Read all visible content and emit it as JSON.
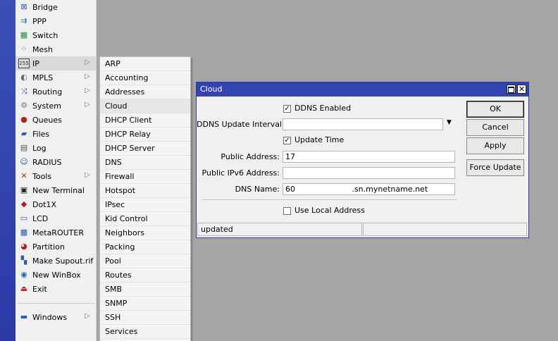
{
  "main_menu": [
    {
      "label": "Bridge",
      "icon": "bridge-icon",
      "glyph": "⊠",
      "color": "#2b5eaa"
    },
    {
      "label": "PPP",
      "icon": "ppp-icon",
      "glyph": "⇉",
      "color": "#2b5eaa"
    },
    {
      "label": "Switch",
      "icon": "switch-icon",
      "glyph": "▦",
      "color": "#2a8a3a"
    },
    {
      "label": "Mesh",
      "icon": "mesh-icon",
      "glyph": "⁘",
      "color": "#2b5eaa"
    },
    {
      "label": "IP",
      "icon": "ip-icon",
      "glyph": "255",
      "color": "#333333",
      "submenu": true
    },
    {
      "label": "MPLS",
      "icon": "mpls-icon",
      "glyph": "◐",
      "color": "#666666",
      "submenu": true
    },
    {
      "label": "Routing",
      "icon": "routing-icon",
      "glyph": "⤨",
      "color": "#2b5eaa",
      "submenu": true
    },
    {
      "label": "System",
      "icon": "system-icon",
      "glyph": "⚙",
      "color": "#777777",
      "submenu": true
    },
    {
      "label": "Queues",
      "icon": "queues-icon",
      "glyph": "●",
      "color": "#b22222"
    },
    {
      "label": "Files",
      "icon": "files-icon",
      "glyph": "▰",
      "color": "#2b5eaa"
    },
    {
      "label": "Log",
      "icon": "log-icon",
      "glyph": "▤",
      "color": "#555555"
    },
    {
      "label": "RADIUS",
      "icon": "radius-icon",
      "glyph": "☺",
      "color": "#2b5eaa"
    },
    {
      "label": "Tools",
      "icon": "tools-icon",
      "glyph": "✕",
      "color": "#8b4513",
      "submenu": true
    },
    {
      "label": "New Terminal",
      "icon": "terminal-icon",
      "glyph": "▣",
      "color": "#222222"
    },
    {
      "label": "Dot1X",
      "icon": "dot1x-icon",
      "glyph": "◆",
      "color": "#b22222"
    },
    {
      "label": "LCD",
      "icon": "lcd-icon",
      "glyph": "▭",
      "color": "#2b5eaa"
    },
    {
      "label": "MetaROUTER",
      "icon": "metarouter-icon",
      "glyph": "▩",
      "color": "#2b5eaa"
    },
    {
      "label": "Partition",
      "icon": "partition-icon",
      "glyph": "◕",
      "color": "#b22222"
    },
    {
      "label": "Make Supout.rif",
      "icon": "supout-icon",
      "glyph": "▚",
      "color": "#2b5eaa"
    },
    {
      "label": "New WinBox",
      "icon": "winbox-icon",
      "glyph": "◉",
      "color": "#2b5eaa"
    },
    {
      "label": "Exit",
      "icon": "exit-icon",
      "glyph": "⏏",
      "color": "#b22222"
    }
  ],
  "windows_item": {
    "label": "Windows",
    "icon": "windows-icon",
    "glyph": "▬",
    "color": "#2b5eaa"
  },
  "ip_submenu": [
    "ARP",
    "Accounting",
    "Addresses",
    "Cloud",
    "DHCP Client",
    "DHCP Relay",
    "DHCP Server",
    "DNS",
    "Firewall",
    "Hotspot",
    "IPsec",
    "Kid Control",
    "Neighbors",
    "Packing",
    "Pool",
    "Routes",
    "SMB",
    "SNMP",
    "SSH",
    "Services"
  ],
  "dialog": {
    "title": "Cloud",
    "ddns_enabled_label": "DDNS Enabled",
    "ddns_enabled_checked": true,
    "ddns_interval_label": "DDNS Update Interval:",
    "ddns_interval_value": "",
    "update_time_label": "Update Time",
    "update_time_checked": true,
    "public_address_label": "Public Address:",
    "public_address_value": "17",
    "public_ipv6_label": "Public IPv6 Address:",
    "public_ipv6_value": "",
    "dns_name_label": "DNS Name:",
    "dns_name_value": "60                       .sn.mynetname.net",
    "use_local_label": "Use Local Address",
    "use_local_checked": false,
    "buttons": {
      "ok": "OK",
      "cancel": "Cancel",
      "apply": "Apply",
      "force_update": "Force Update"
    },
    "status_left": "updated",
    "status_right": ""
  },
  "colors": {
    "desktop": "#a5a5a5",
    "sidebar": "#3344b0",
    "titlebar": "#3344b0",
    "menu_bg": "#f0f0f0"
  }
}
